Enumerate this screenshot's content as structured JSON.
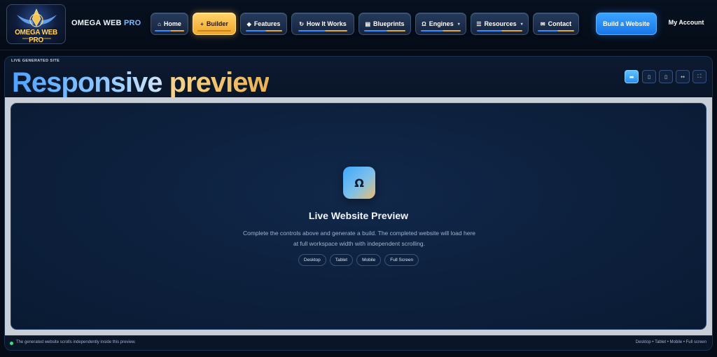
{
  "brand": {
    "logo_text": "OMEGA WEB PRO",
    "name_main": "OMEGA WEB",
    "name_accent": "PRO"
  },
  "nav": {
    "items": [
      {
        "label": "Home",
        "icon": "home-icon",
        "glyph": "⌂"
      },
      {
        "label": "Builder",
        "icon": "plus-icon",
        "glyph": "+"
      },
      {
        "label": "Features",
        "icon": "diamond-icon",
        "glyph": "◆"
      },
      {
        "label": "How It Works",
        "icon": "refresh-icon",
        "glyph": "↻"
      },
      {
        "label": "Blueprints",
        "icon": "blueprint-icon",
        "glyph": "▤"
      },
      {
        "label": "Engines",
        "icon": "omega-icon",
        "glyph": "Ω"
      },
      {
        "label": "Resources",
        "icon": "list-icon",
        "glyph": "☰"
      },
      {
        "label": "Contact",
        "icon": "mail-icon",
        "glyph": "✉"
      }
    ],
    "cta_label": "Build a Website",
    "account_label": "My Account"
  },
  "preview": {
    "eyebrow": "LIVE GENERATED SITE",
    "title_part1": "Responsive",
    "title_part2": "preview",
    "device_buttons": [
      {
        "name": "desktop-view-icon",
        "glyph": "▬"
      },
      {
        "name": "tablet-view-icon",
        "glyph": "▯"
      },
      {
        "name": "mobile-view-icon",
        "glyph": "▯"
      },
      {
        "name": "fit-width-icon",
        "glyph": "↔"
      },
      {
        "name": "fullscreen-icon",
        "glyph": "⛶"
      }
    ],
    "placeholder": {
      "icon_glyph": "Ω",
      "title": "Live Website Preview",
      "line1": "Complete the controls above and generate a build. The completed website will load here",
      "line2": "at full workspace width with independent scrolling.",
      "chips": [
        "Desktop",
        "Tablet",
        "Mobile",
        "Full Screen"
      ]
    },
    "footer_left": "The generated website scrolls independently inside this preview.",
    "footer_right": "Desktop • Tablet • Mobile • Full screen"
  },
  "colors": {
    "accent_blue": "#2a8ef0",
    "accent_gold": "#f1a62b",
    "status_green": "#3ddc84"
  }
}
